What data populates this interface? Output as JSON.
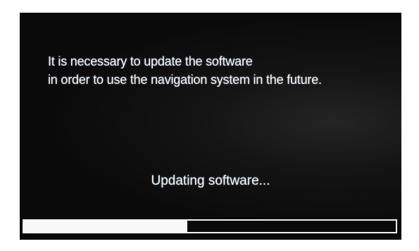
{
  "message": {
    "line1": "It is necessary to update the software",
    "line2": "in order to use the navigation system in the future."
  },
  "status": {
    "label": "Updating software..."
  },
  "progress": {
    "percent": 44
  },
  "colors": {
    "screen_background": "#0a0a0a",
    "text": "#f2f6fa",
    "progress_fill": "#f6f8fa",
    "progress_border": "#eef2f6"
  }
}
